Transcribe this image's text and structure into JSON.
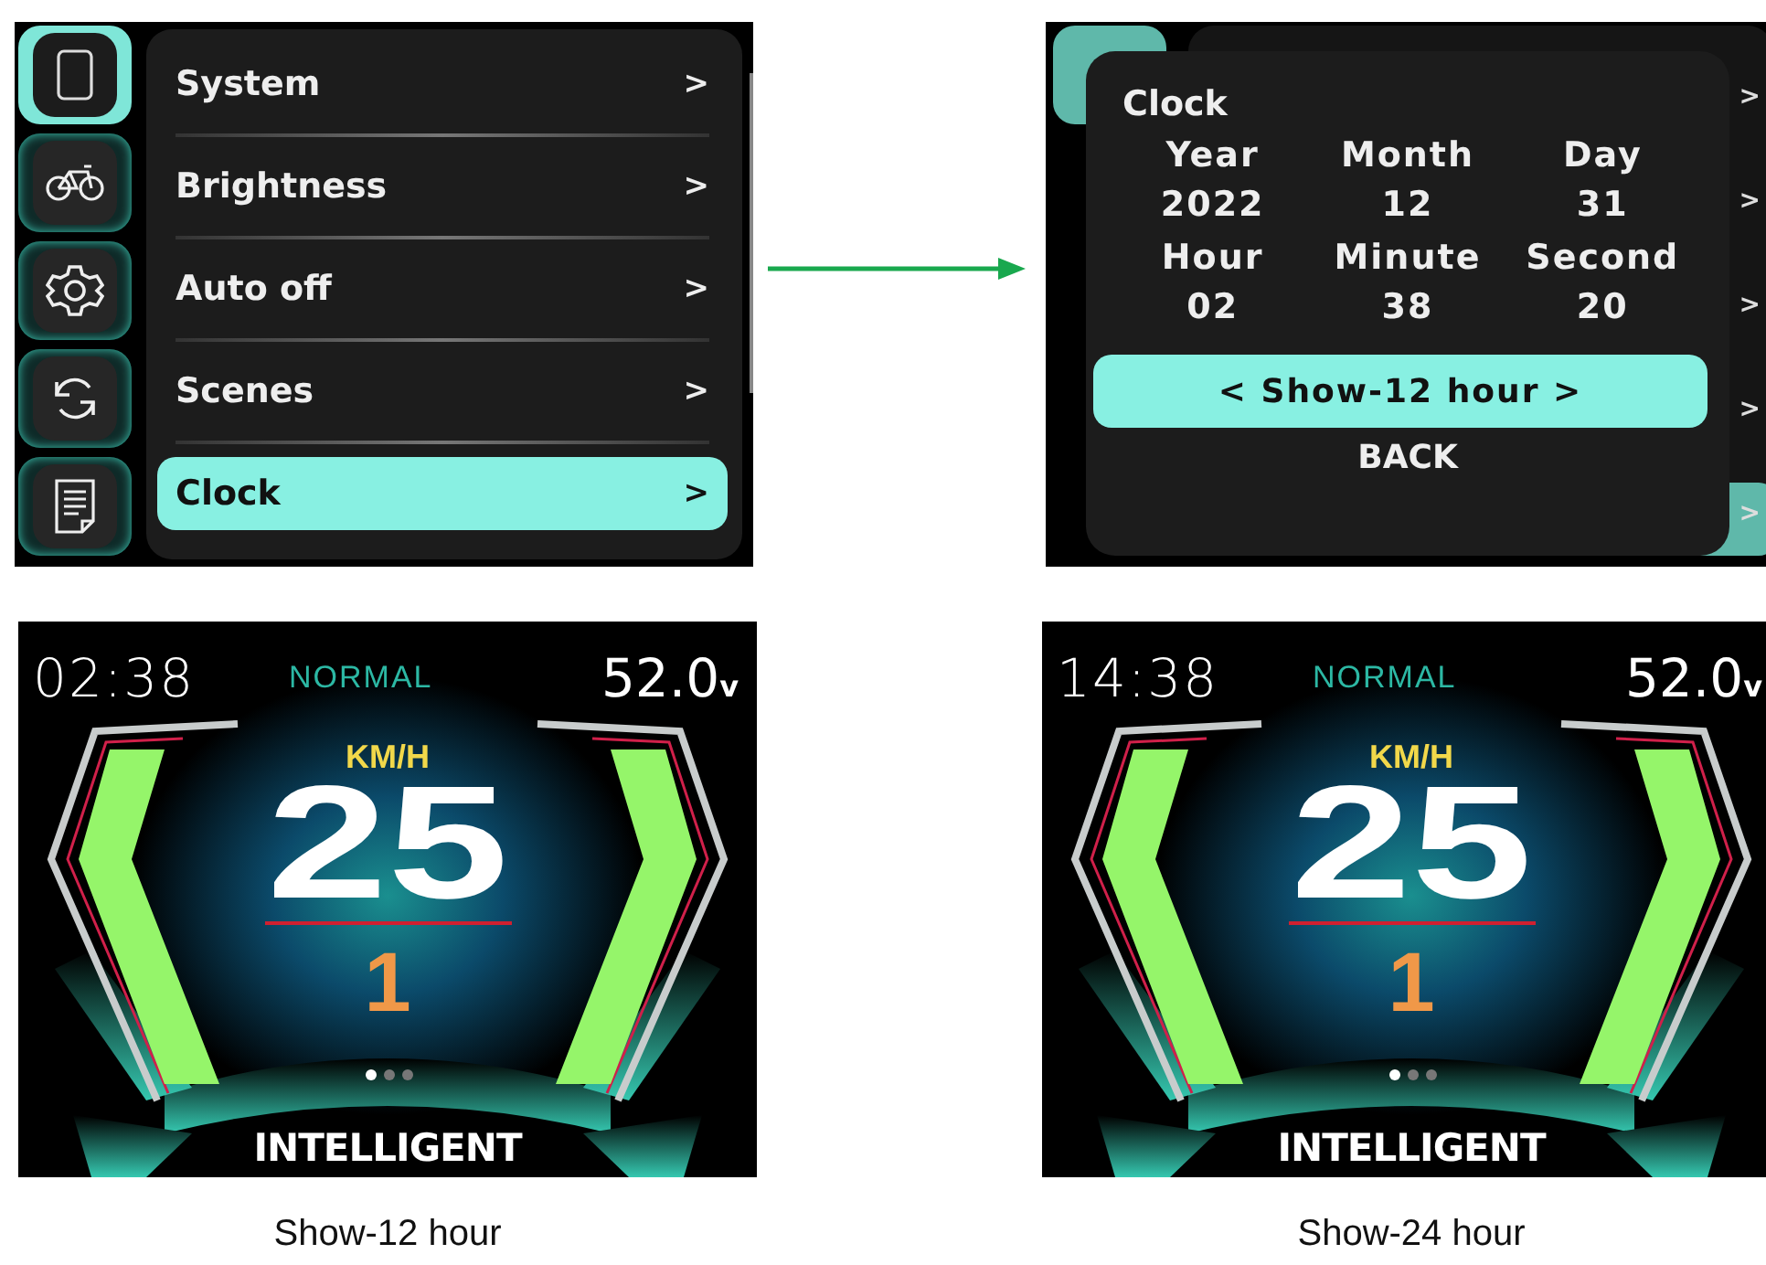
{
  "menu_screen": {
    "sidebar": [
      {
        "kind": "tablet",
        "selected": true
      },
      {
        "kind": "bicycle",
        "selected": false
      },
      {
        "kind": "gear",
        "selected": false
      },
      {
        "kind": "sync",
        "selected": false
      },
      {
        "kind": "document",
        "selected": false
      }
    ],
    "items": [
      {
        "label": "System",
        "arrow": ">",
        "selected": false
      },
      {
        "label": "Brightness",
        "arrow": ">",
        "selected": false
      },
      {
        "label": "Auto off",
        "arrow": ">",
        "selected": false
      },
      {
        "label": "Scenes",
        "arrow": ">",
        "selected": false
      },
      {
        "label": "Clock",
        "arrow": ">",
        "selected": true
      }
    ]
  },
  "clock_screen": {
    "behind_arrows": [
      ">",
      ">",
      ">",
      ">",
      ">"
    ],
    "title": "Clock",
    "fields": [
      {
        "label": "Year",
        "value": "2022"
      },
      {
        "label": "Month",
        "value": "12"
      },
      {
        "label": "Day",
        "value": "31"
      },
      {
        "label": "Hour",
        "value": "02"
      },
      {
        "label": "Minute",
        "value": "38"
      },
      {
        "label": "Second",
        "value": "20"
      }
    ],
    "format_option": "< Show-12 hour >",
    "back": "BACK"
  },
  "dashboards": [
    {
      "time": "02:38",
      "mode": "NORMAL",
      "voltage": "52.0",
      "voltage_unit": "v",
      "unit": "KM/H",
      "speed": "25",
      "gear": "1",
      "pages": [
        {
          "selected": true
        },
        {
          "selected": false
        },
        {
          "selected": false
        }
      ],
      "assist": "INTELLIGENT",
      "caption": "Show-12 hour"
    },
    {
      "time": "14:38",
      "mode": "NORMAL",
      "voltage": "52.0",
      "voltage_unit": "v",
      "unit": "KM/H",
      "speed": "25",
      "gear": "1",
      "pages": [
        {
          "selected": true
        },
        {
          "selected": false
        },
        {
          "selected": false
        }
      ],
      "assist": "INTELLIGENT",
      "caption": "Show-24 hour"
    }
  ]
}
